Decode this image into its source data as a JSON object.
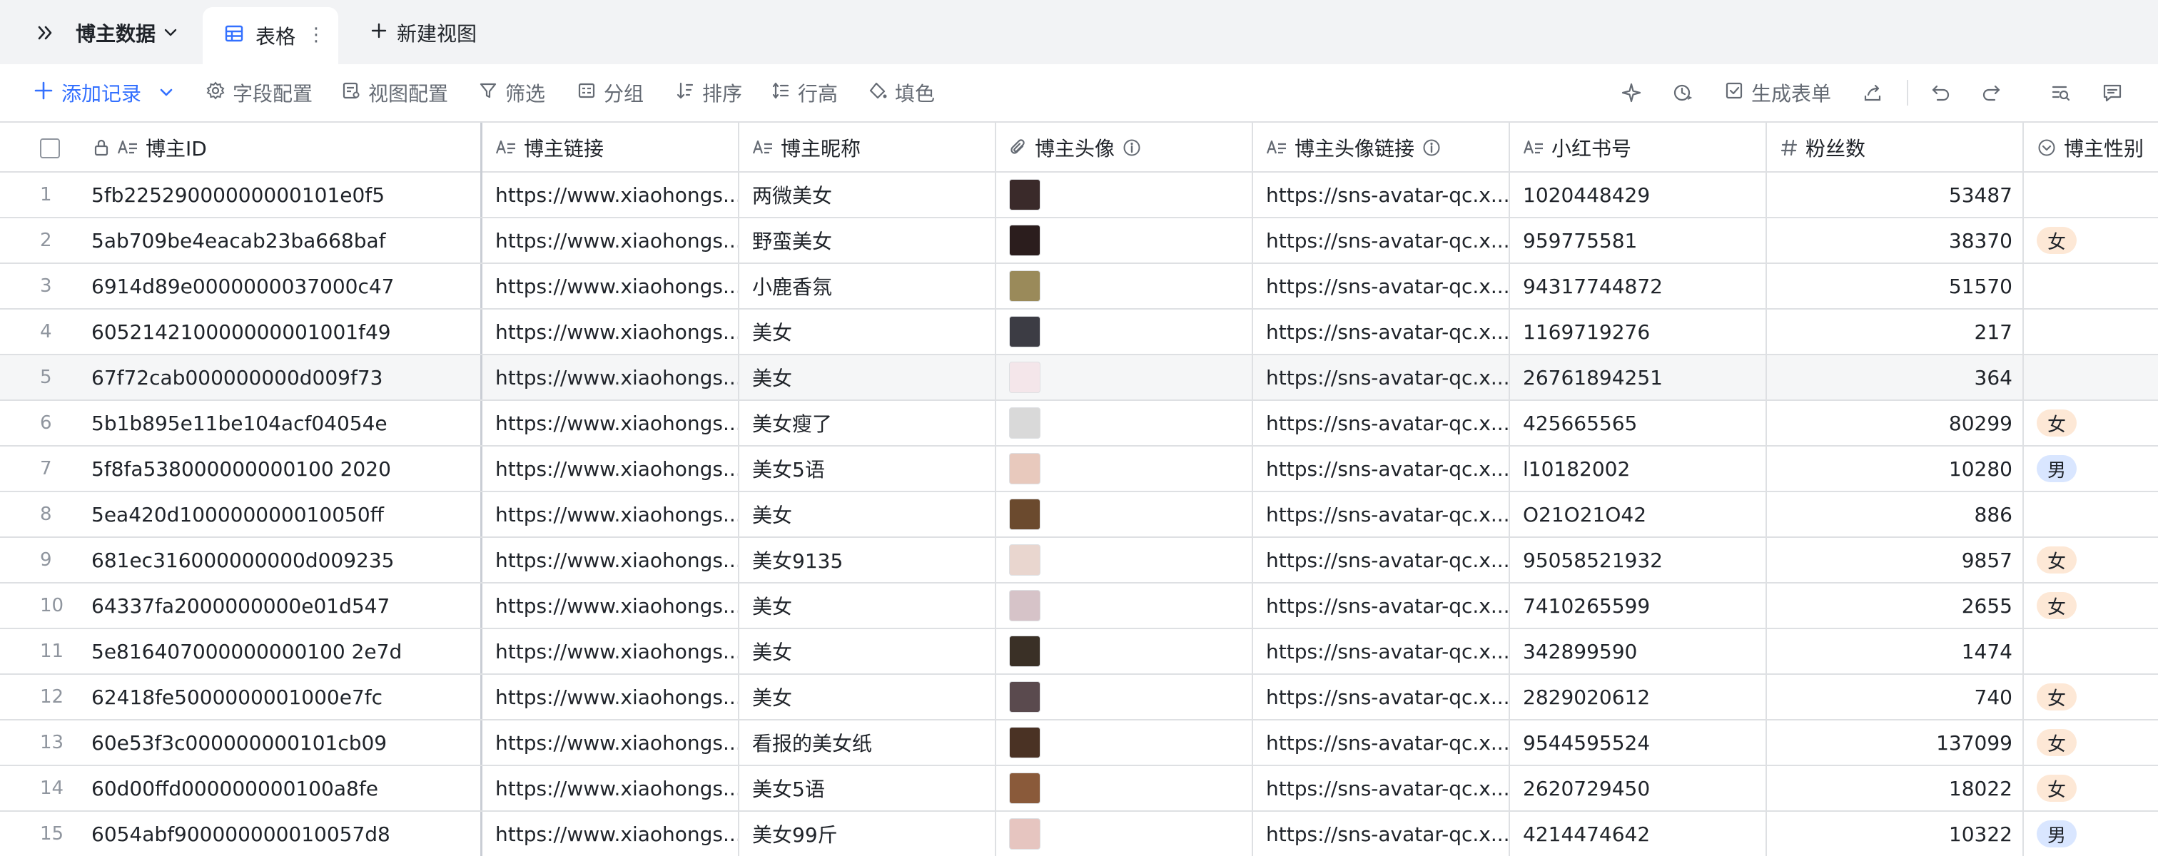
{
  "tabbar": {
    "dataset_name": "博主数据",
    "active_view": "表格",
    "new_view": "新建视图"
  },
  "toolbar": {
    "add_record": "添加记录",
    "field_config": "字段配置",
    "view_config": "视图配置",
    "filter": "筛选",
    "group": "分组",
    "sort": "排序",
    "row_height": "行高",
    "fill": "填色",
    "generate_form": "生成表单"
  },
  "columns": [
    {
      "key": "id",
      "label": "博主ID",
      "icon": "text-icon"
    },
    {
      "key": "link",
      "label": "博主链接",
      "icon": "text-icon"
    },
    {
      "key": "nickname",
      "label": "博主昵称",
      "icon": "text-icon"
    },
    {
      "key": "avatar",
      "label": "博主头像",
      "icon": "attachment-icon"
    },
    {
      "key": "avatar_link",
      "label": "博主头像链接",
      "icon": "text-icon"
    },
    {
      "key": "xhs",
      "label": "小红书号",
      "icon": "text-icon"
    },
    {
      "key": "fans",
      "label": "粉丝数",
      "icon": "number-icon"
    },
    {
      "key": "gender",
      "label": "博主性别",
      "icon": "single-select-icon"
    }
  ],
  "rows": [
    {
      "num": "1",
      "id": "5fb22529000000000101e0f5",
      "link": "https://www.xiaohongs...",
      "nickname": "两微美女",
      "avatar_link": "https://sns-avatar-qc.x...",
      "xhs": "1020448429",
      "fans": "53487",
      "gender": "",
      "avatar_color": "#3a2a2a"
    },
    {
      "num": "2",
      "id": "5ab709be4eacab23ba668baf",
      "link": "https://www.xiaohongs...",
      "nickname": "野蛮美女",
      "avatar_link": "https://sns-avatar-qc.x...",
      "xhs": "959775581",
      "fans": "38370",
      "gender": "女",
      "avatar_color": "#2b1d1d"
    },
    {
      "num": "3",
      "id": "6914d89e0000000037000c47",
      "link": "https://www.xiaohongs...",
      "nickname": "小鹿香氛",
      "avatar_link": "https://sns-avatar-qc.x...",
      "xhs": "94317744872",
      "fans": "51570",
      "gender": "",
      "avatar_color": "#9a8a5a"
    },
    {
      "num": "4",
      "id": "605214210000000001001f49",
      "link": "https://www.xiaohongs...",
      "nickname": "美女",
      "avatar_link": "https://sns-avatar-qc.x...",
      "xhs": "1169719276",
      "fans": "217",
      "gender": "",
      "avatar_color": "#3c3c44"
    },
    {
      "num": "5",
      "id": "67f72cab000000000d009f73",
      "link": "https://www.xiaohongs...",
      "nickname": "美女",
      "avatar_link": "https://sns-avatar-qc.x...",
      "xhs": "26761894251",
      "fans": "364",
      "gender": "",
      "avatar_color": "#f4e6ea"
    },
    {
      "num": "6",
      "id": "5b1b895e11be104acf04054e",
      "link": "https://www.xiaohongs...",
      "nickname": "美女瘦了",
      "avatar_link": "https://sns-avatar-qc.x...",
      "xhs": "425665565",
      "fans": "80299",
      "gender": "女",
      "avatar_color": "#d9d9d9"
    },
    {
      "num": "7",
      "id": "5f8fa538000000000100 2020",
      "link": "https://www.xiaohongs...",
      "nickname": "美女5语",
      "avatar_link": "https://sns-avatar-qc.x...",
      "xhs": "l10182002",
      "fans": "10280",
      "gender": "男",
      "avatar_color": "#e8c9bd"
    },
    {
      "num": "8",
      "id": "5ea420d100000000010050ff",
      "link": "https://www.xiaohongs...",
      "nickname": "美女",
      "avatar_link": "https://sns-avatar-qc.x...",
      "xhs": "O21O21O42",
      "fans": "886",
      "gender": "",
      "avatar_color": "#6b4a2e"
    },
    {
      "num": "9",
      "id": "681ec316000000000d009235",
      "link": "https://www.xiaohongs...",
      "nickname": "美女9135",
      "avatar_link": "https://sns-avatar-qc.x...",
      "xhs": "95058521932",
      "fans": "9857",
      "gender": "女",
      "avatar_color": "#e9d6cf"
    },
    {
      "num": "10",
      "id": "64337fa2000000000e01d547",
      "link": "https://www.xiaohongs...",
      "nickname": "美女",
      "avatar_link": "https://sns-avatar-qc.x...",
      "xhs": "7410265599",
      "fans": "2655",
      "gender": "女",
      "avatar_color": "#d6c3c8"
    },
    {
      "num": "11",
      "id": "5e816407000000000100 2e7d",
      "link": "https://www.xiaohongs...",
      "nickname": "美女",
      "avatar_link": "https://sns-avatar-qc.x...",
      "xhs": "342899590",
      "fans": "1474",
      "gender": "",
      "avatar_color": "#3a3026"
    },
    {
      "num": "12",
      "id": "62418fe5000000001000e7fc",
      "link": "https://www.xiaohongs...",
      "nickname": "美女",
      "avatar_link": "https://sns-avatar-qc.x...",
      "xhs": "2829020612",
      "fans": "740",
      "gender": "女",
      "avatar_color": "#5a4a4e"
    },
    {
      "num": "13",
      "id": "60e53f3c000000000101cb09",
      "link": "https://www.xiaohongs...",
      "nickname": "看报的美女纸",
      "avatar_link": "https://sns-avatar-qc.x...",
      "xhs": "9544595524",
      "fans": "137099",
      "gender": "女",
      "avatar_color": "#4a3224"
    },
    {
      "num": "14",
      "id": "60d00ffd000000000100a8fe",
      "link": "https://www.xiaohongs...",
      "nickname": "美女5语",
      "avatar_link": "https://sns-avatar-qc.x...",
      "xhs": "2620729450",
      "fans": "18022",
      "gender": "女",
      "avatar_color": "#8a5a3a"
    },
    {
      "num": "15",
      "id": "6054abf900000000010057d8",
      "link": "https://www.xiaohongs...",
      "nickname": "美女99斤",
      "avatar_link": "https://sns-avatar-qc.x...",
      "xhs": "4214474642",
      "fans": "10322",
      "gender": "男",
      "avatar_color": "#e6c5c0"
    }
  ],
  "colors": {
    "accent": "#3370ff",
    "tag_female": "#fde8d6",
    "tag_male": "#d9e6ff"
  }
}
